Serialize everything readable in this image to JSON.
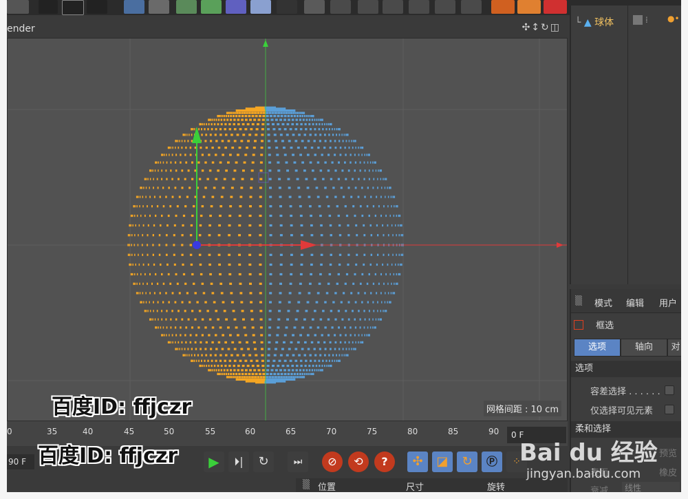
{
  "viewport": {
    "menu_partial": "ender",
    "nav_icons": "✣↕↻◫",
    "grid_spacing": "网格间距 : 10 cm"
  },
  "object_manager": {
    "object_name": "球体"
  },
  "attributes": {
    "menu": [
      "模式",
      "编辑",
      "用户"
    ],
    "tool_name": "框选",
    "tabs": [
      "选项",
      "轴向",
      "对"
    ],
    "section_title": "选项",
    "options": [
      "容差选择 . . . . . .",
      "仅选择可见元素"
    ],
    "faded_section": "柔和选择",
    "faded_right_1": "预览",
    "faded_right_2": "橡皮",
    "faded_left": "表面",
    "faded_bottom_left": "衰减",
    "faded_bottom_value": "线性"
  },
  "timeline": {
    "ticks": [
      "0",
      "35",
      "40",
      "45",
      "50",
      "55",
      "60",
      "65",
      "70",
      "75",
      "80",
      "85",
      "90"
    ],
    "current_frame": "0 F",
    "end_frame": "90 F"
  },
  "coords": {
    "labels": [
      "位置",
      "尺寸",
      "旋转"
    ]
  },
  "watermarks": {
    "baidu_id_1": "百度ID: ffjczr",
    "baidu_id_2": "百度ID: ffjczr",
    "baidu_logo": "Bai du 经验",
    "baidu_url": "jingyan.baidu.com"
  },
  "colors": {
    "selected": "#f5a623",
    "unselected": "#5b9fd8",
    "x_axis": "#e03a3a",
    "y_axis": "#3ad03a",
    "z_axis": "#3a3ae0",
    "tab_active": "#5b84c4"
  }
}
